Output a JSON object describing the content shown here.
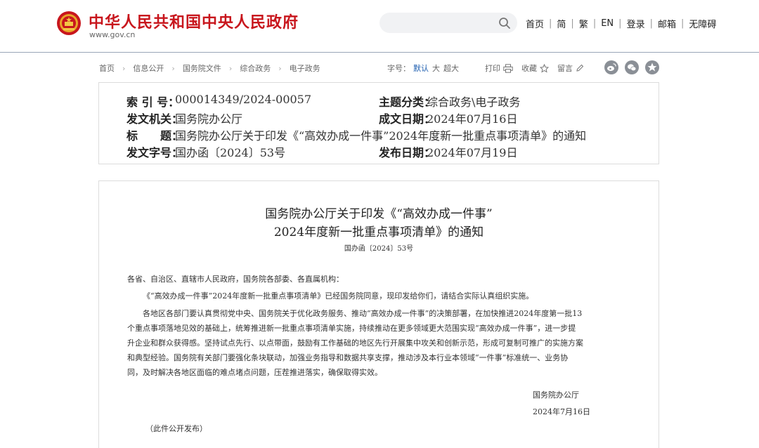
{
  "header": {
    "site_name": "中华人民共和国中央人民政府",
    "domain": "www.gov.cn",
    "search_placeholder": "",
    "nav": [
      "首页",
      "简",
      "繁",
      "EN",
      "登录",
      "邮箱",
      "无障碍"
    ]
  },
  "breadcrumb": [
    "首页",
    "信息公开",
    "国务院文件",
    "综合政务",
    "电子政务"
  ],
  "toolbar": {
    "font_label": "字号：",
    "font_sizes": [
      "默认",
      "大",
      "超大"
    ],
    "print": "打印",
    "favorite": "收藏",
    "comment": "留言"
  },
  "meta": {
    "index_label": "索 引 号：",
    "index": "000014349/2024-00057",
    "category_label": "主题分类：",
    "category": "综合政务\\电子政务",
    "issuer_label": "发文机关：",
    "issuer": "国务院办公厅",
    "date_written_label": "成文日期：",
    "date_written": "2024年07月16日",
    "title_label": "标　　题：",
    "title": "国务院办公厅关于印发《“高效办成一件事”2024年度新一批重点事项清单》的通知",
    "doc_no_label": "发文字号：",
    "doc_no": "国办函〔2024〕53号",
    "publish_label": "发布日期：",
    "publish": "2024年07月19日"
  },
  "document": {
    "title_line1": "国务院办公厅关于印发《“高效办成一件事”",
    "title_line2": "2024年度新一批重点事项清单》的通知",
    "number": "国办函〔2024〕53号",
    "salutation": "各省、自治区、直辖市人民政府，国务院各部委、各直属机构：",
    "para1": "《“高效办成一件事”2024年度新一批重点事项清单》已经国务院同意，现印发给你们，请结合实际认真组织实施。",
    "para2_lines": [
      "各地区各部门要认真贯彻党中央、国务院关于优化政务服务、推动“高效办成一件事”的决策部署，在加快推进2024年度第一批13",
      "个重点事项落地见效的基础上，统筹推进新一批重点事项清单实施，持续推动在更多领域更大范围实现“高效办成一件事”，进一步提",
      "升企业和群众获得感。坚持试点先行、以点带面，鼓励有工作基础的地区先行开展集中攻关和创新示范，形成可复制可推广的实施方案",
      "和典型经验。国务院有关部门要强化条块联动，加强业务指导和数据共享支撑，推动涉及本行业本领域“一件事”标准统一、业务协",
      "同，及时解决各地区面临的难点堵点问题，压茬推进落实，确保取得实效。"
    ],
    "signatory": "国务院办公厅",
    "sign_date": "2024年7月16日",
    "footnote": "（此件公开发布）"
  },
  "colors": {
    "brand_red": "#c8161d",
    "accent_blue": "#1f5fb0",
    "share_gray": "#8a8f96"
  },
  "icons": [
    "national-emblem-icon",
    "search-icon",
    "print-icon",
    "star-icon",
    "pencil-icon",
    "weibo-icon",
    "wechat-icon",
    "qzone-icon"
  ]
}
